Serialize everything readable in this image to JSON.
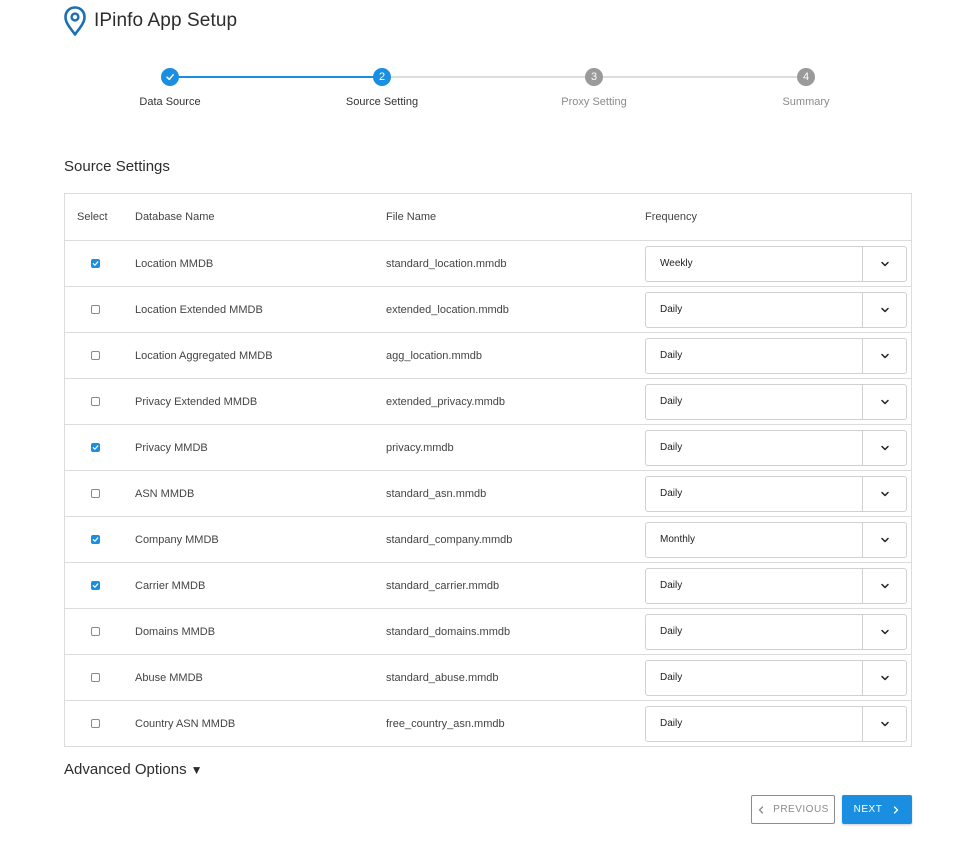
{
  "app": {
    "title": "IPinfo App Setup"
  },
  "colors": {
    "accent": "#1a8ee0",
    "inactive": "#9a9a9a"
  },
  "steps": [
    {
      "number": "",
      "label": "Data Source",
      "state": "completed"
    },
    {
      "number": "2",
      "label": "Source Setting",
      "state": "active"
    },
    {
      "number": "3",
      "label": "Proxy Setting",
      "state": "inactive"
    },
    {
      "number": "4",
      "label": "Summary",
      "state": "inactive"
    }
  ],
  "section": {
    "title": "Source Settings"
  },
  "table": {
    "headers": {
      "select": "Select",
      "database": "Database Name",
      "file": "File Name",
      "frequency": "Frequency"
    },
    "rows": [
      {
        "checked": true,
        "database": "Location MMDB",
        "file": "standard_location.mmdb",
        "frequency": "Weekly"
      },
      {
        "checked": false,
        "database": "Location Extended MMDB",
        "file": "extended_location.mmdb",
        "frequency": "Daily"
      },
      {
        "checked": false,
        "database": "Location Aggregated MMDB",
        "file": "agg_location.mmdb",
        "frequency": "Daily"
      },
      {
        "checked": false,
        "database": "Privacy Extended MMDB",
        "file": "extended_privacy.mmdb",
        "frequency": "Daily"
      },
      {
        "checked": true,
        "database": "Privacy MMDB",
        "file": "privacy.mmdb",
        "frequency": "Daily"
      },
      {
        "checked": false,
        "database": "ASN MMDB",
        "file": "standard_asn.mmdb",
        "frequency": "Daily"
      },
      {
        "checked": true,
        "database": "Company MMDB",
        "file": "standard_company.mmdb",
        "frequency": "Monthly"
      },
      {
        "checked": true,
        "database": "Carrier MMDB",
        "file": "standard_carrier.mmdb",
        "frequency": "Daily"
      },
      {
        "checked": false,
        "database": "Domains MMDB",
        "file": "standard_domains.mmdb",
        "frequency": "Daily"
      },
      {
        "checked": false,
        "database": "Abuse MMDB",
        "file": "standard_abuse.mmdb",
        "frequency": "Daily"
      },
      {
        "checked": false,
        "database": "Country ASN MMDB",
        "file": "free_country_asn.mmdb",
        "frequency": "Daily"
      }
    ]
  },
  "advanced": {
    "label": "Advanced Options",
    "indicator": "▼"
  },
  "buttons": {
    "previous": "PREVIOUS",
    "next": "NEXT"
  }
}
